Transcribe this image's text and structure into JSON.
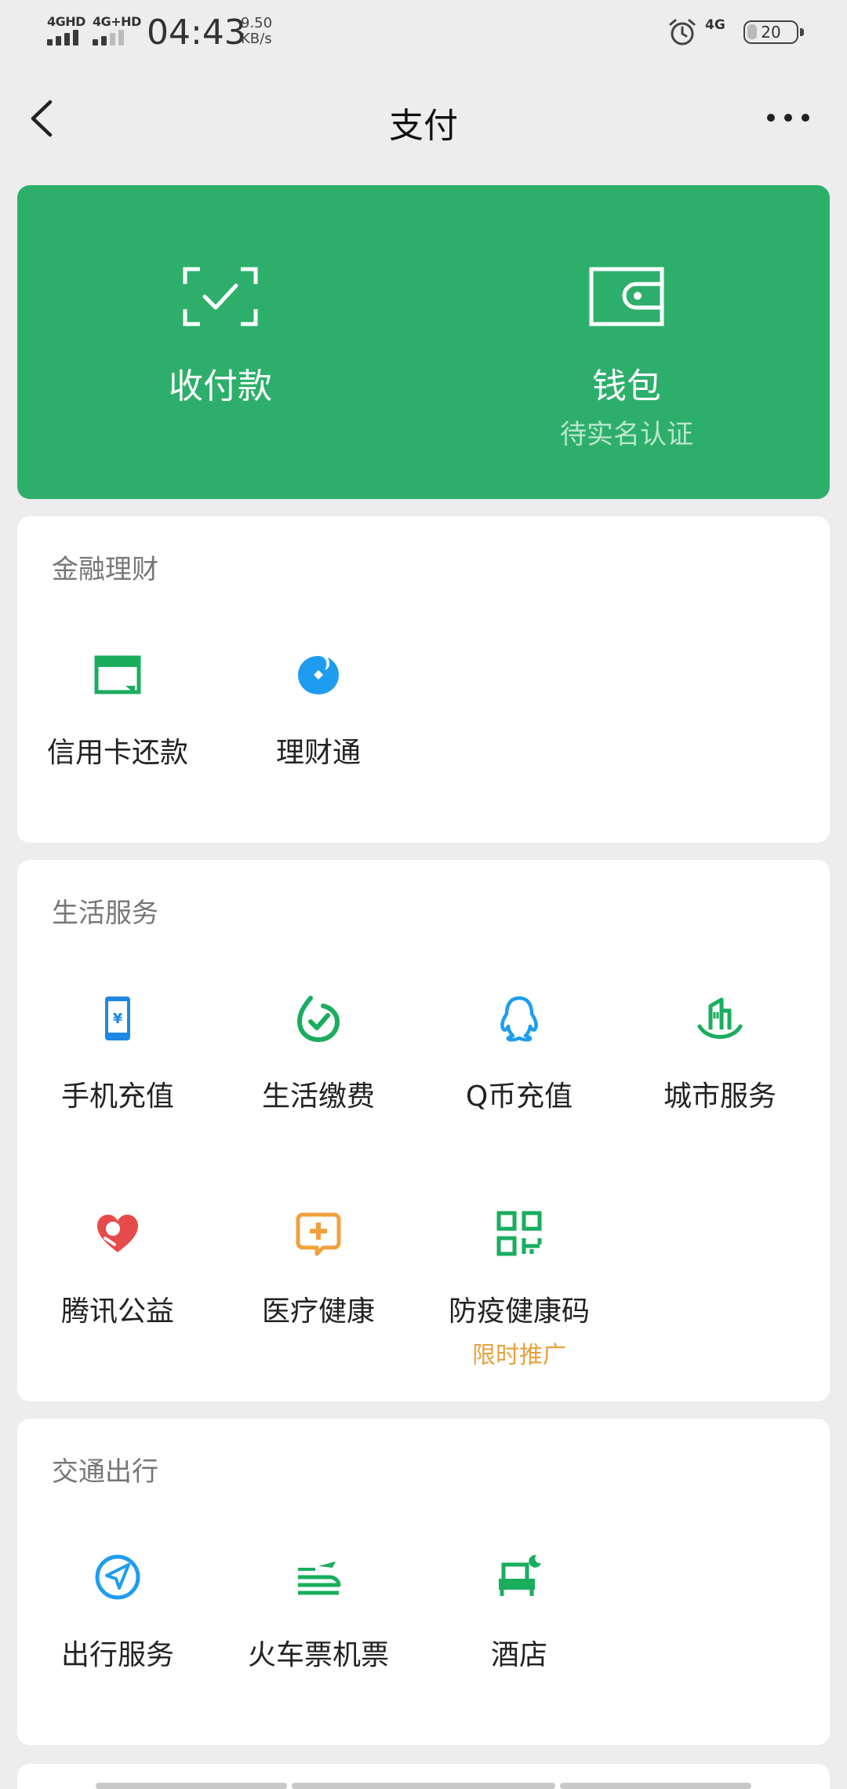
{
  "status_bar": {
    "sim1": "4GHD",
    "sim2": "4G+HD",
    "time": "04:43",
    "speed_value": "9.50",
    "speed_unit": "KB/s",
    "net": "4G",
    "battery": "20",
    "icons": [
      "signal-icon",
      "alarm-icon",
      "battery-icon"
    ]
  },
  "nav": {
    "title": "支付",
    "icons": [
      "back-arrow-icon",
      "more-icon"
    ]
  },
  "green_card": {
    "color": "#2daf6b",
    "pay": {
      "label": "收付款",
      "icon": "scan-check-icon"
    },
    "wallet": {
      "label": "钱包",
      "sub": "待实名认证",
      "icon": "wallet-icon"
    }
  },
  "finance": {
    "title": "金融理财",
    "items": [
      {
        "label": "信用卡还款",
        "icon": "credit-card-icon",
        "color": "#1aad5e"
      },
      {
        "label": "理财通",
        "icon": "licaitong-icon",
        "color": "#1e9cf0"
      }
    ]
  },
  "life": {
    "title": "生活服务",
    "items": [
      {
        "label": "手机充值",
        "icon": "phone-recharge-icon",
        "color": "#1e88e5"
      },
      {
        "label": "生活缴费",
        "icon": "bill-pay-icon",
        "color": "#1aad5e"
      },
      {
        "label": "Q币充值",
        "icon": "qq-penguin-icon",
        "color": "#1e9cf0"
      },
      {
        "label": "城市服务",
        "icon": "city-service-icon",
        "color": "#1aad5e"
      },
      {
        "label": "腾讯公益",
        "icon": "charity-heart-icon",
        "color": "#e64a4a"
      },
      {
        "label": "医疗健康",
        "icon": "medical-icon",
        "color": "#f0a13c"
      },
      {
        "label": "防疫健康码",
        "icon": "qr-code-icon",
        "color": "#1aad5e",
        "promo": "限时推广"
      }
    ]
  },
  "transport": {
    "title": "交通出行",
    "items": [
      {
        "label": "出行服务",
        "icon": "navigation-icon",
        "color": "#1e9cf0"
      },
      {
        "label": "火车票机票",
        "icon": "train-plane-icon",
        "color": "#1aad5e"
      },
      {
        "label": "酒店",
        "icon": "hotel-bed-icon",
        "color": "#1aad5e"
      }
    ]
  }
}
